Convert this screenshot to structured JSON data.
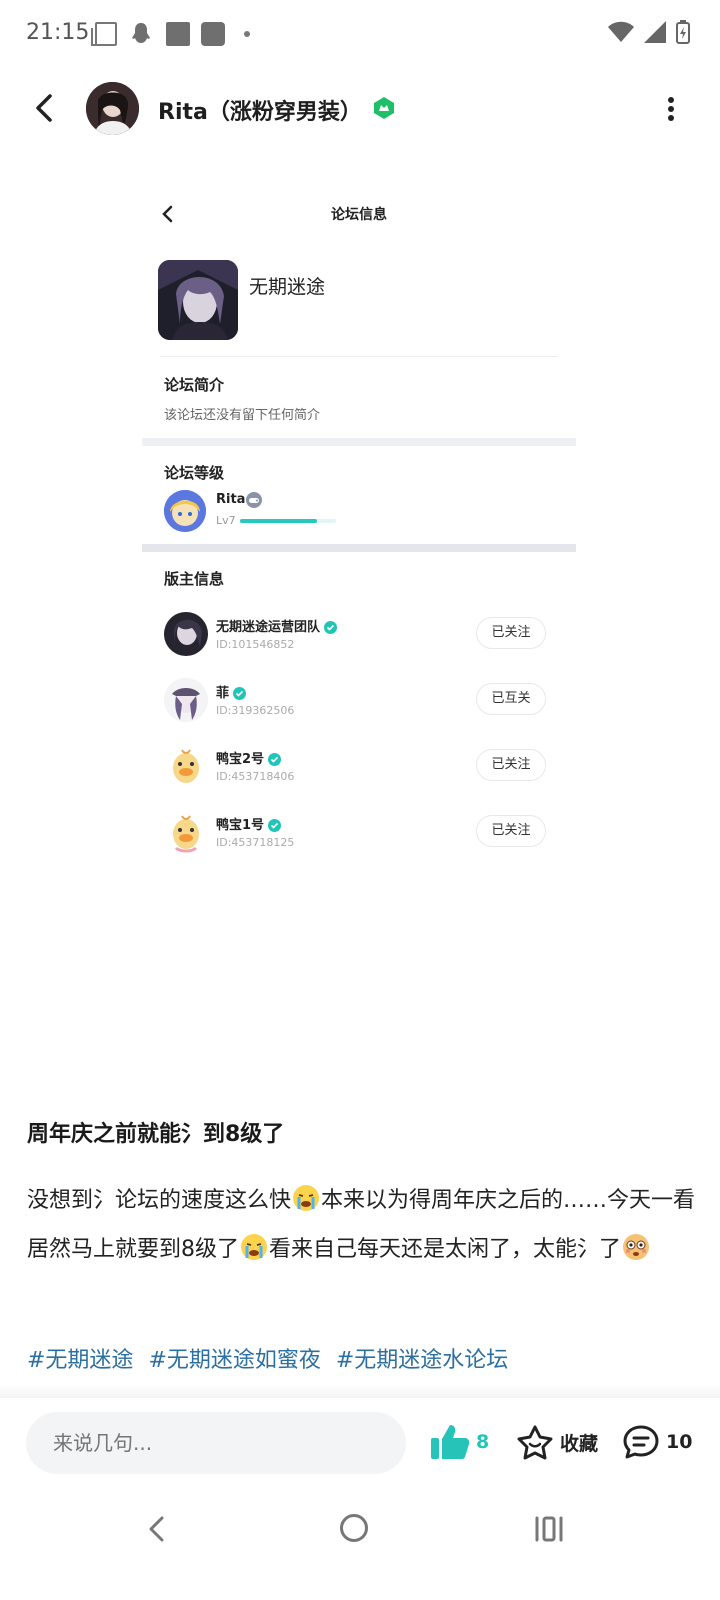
{
  "status_bar": {
    "time": "21:15"
  },
  "header": {
    "author_name": "Rita（涨粉穿男装）"
  },
  "embedded_screenshot": {
    "title": "论坛信息",
    "forum_name": "无期迷途",
    "intro_label": "论坛简介",
    "intro_text": "该论坛还没有留下任何简介",
    "level_label": "论坛等级",
    "level_user": {
      "name": "Rita",
      "level": "Lv7",
      "progress": 0.8
    },
    "moderators_label": "版主信息",
    "moderators": [
      {
        "name": "无期迷途运营团队",
        "id": "ID:101546852",
        "button": "已关注"
      },
      {
        "name": "菲",
        "id": "ID:319362506",
        "button": "已互关"
      },
      {
        "name": "鸭宝2号",
        "id": "ID:453718406",
        "button": "已关注"
      },
      {
        "name": "鸭宝1号",
        "id": "ID:453718125",
        "button": "已关注"
      }
    ]
  },
  "post": {
    "title": "周年庆之前就能氵到8级了",
    "body_line1": "没想到氵论坛的速度这么快",
    "body_line2": "本来以为得周年庆之后的……今天一看居然马上就要到8级了",
    "body_line3": "看来自己每天还是太闲了，太能氵了",
    "tags": [
      "#无期迷途",
      "#无期迷途如蜜夜",
      "#无期迷途水论坛"
    ]
  },
  "bottom_bar": {
    "comment_placeholder": "来说几句...",
    "like_count": "8",
    "favorite_label": "收藏",
    "comment_count": "10"
  },
  "colors": {
    "accent": "#25c3b8",
    "tag": "#2c6fa1",
    "badge": "#1fbf6a"
  }
}
